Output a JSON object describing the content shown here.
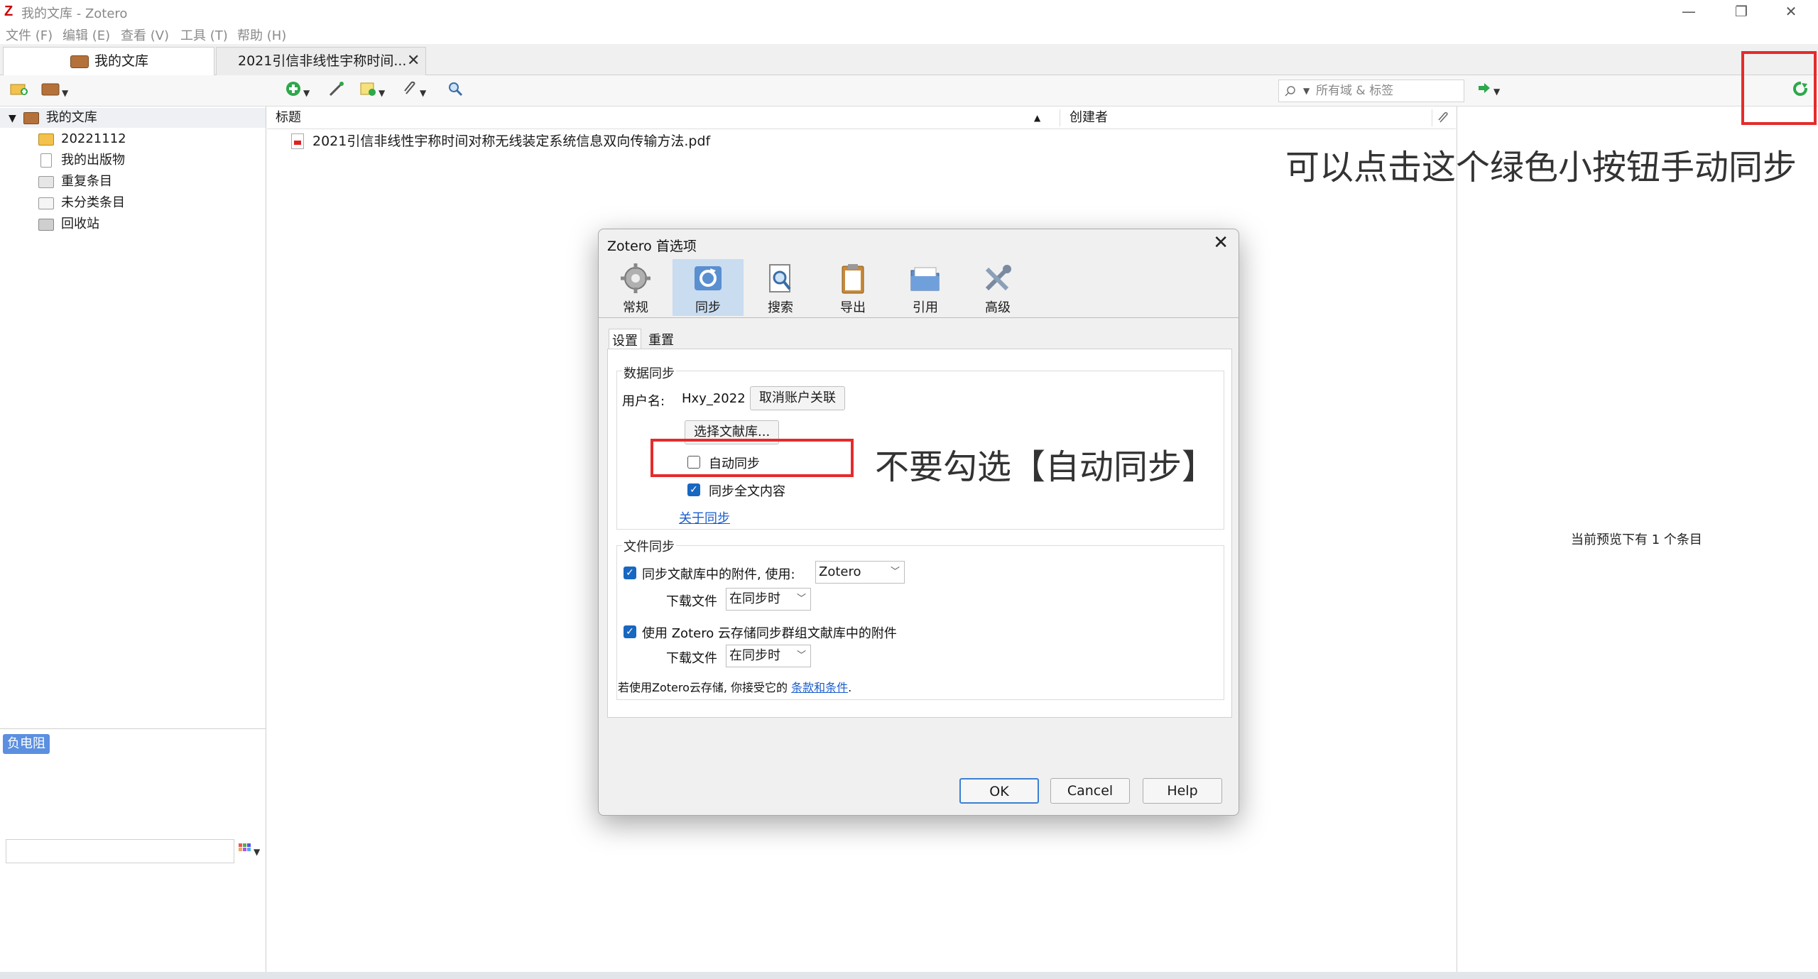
{
  "window": {
    "logo": "Z",
    "title": "我的文库 - Zotero",
    "minimize": "—",
    "restore": "❐",
    "close": "✕"
  },
  "menu": [
    "文件 (F)",
    "编辑 (E)",
    "查看 (V)",
    "工具 (T)",
    "帮助 (H)"
  ],
  "tabs": [
    {
      "label": "我的文库"
    },
    {
      "label": "2021引信非线性宇称时间...",
      "close": "✕"
    }
  ],
  "toolbar": {
    "search_placeholder": "所有域 & 标签",
    "search_icon": "magnifier-icon"
  },
  "collections": {
    "root": "我的文库",
    "items": [
      "20221112",
      "我的出版物",
      "重复条目",
      "未分类条目",
      "回收站"
    ]
  },
  "tags": {
    "chip": "负电阻"
  },
  "columns": {
    "title": "标题",
    "creator": "创建者"
  },
  "items": [
    {
      "title": "2021引信非线性宇称时间对称无线装定系统信息双向传输方法.pdf"
    }
  ],
  "preview": {
    "message": "当前预览下有 1 个条目"
  },
  "annotations": {
    "sync_hint": "可以点击这个绿色小按钮手动同步",
    "auto_sync_hint": "不要勾选【自动同步】"
  },
  "dialog": {
    "title": "Zotero 首选项",
    "panes": [
      "常规",
      "同步",
      "搜索",
      "导出",
      "引用",
      "高级"
    ],
    "selected_pane": "同步",
    "subtabs": [
      "设置",
      "重置"
    ],
    "data_sync": {
      "title": "数据同步",
      "username_label": "用户名:",
      "username": "Hxy_2022",
      "unlink_button": "取消账户关联",
      "choose_libraries_button": "选择文献库...",
      "auto_sync_label": "自动同步",
      "auto_sync_checked": false,
      "fulltext_label": "同步全文内容",
      "fulltext_checked": true,
      "about_link": "关于同步"
    },
    "file_sync": {
      "title": "文件同步",
      "sync_attachments_label": "同步文献库中的附件, 使用:",
      "sync_attachments_checked": true,
      "sync_attachments_service": "Zotero",
      "download_files_label": "下载文件",
      "download_files_value": "在同步时",
      "group_label": "使用 Zotero 云存储同步群组文献库中的附件",
      "group_checked": true,
      "group_download_label": "下载文件",
      "group_download_value": "在同步时",
      "terms_text": "若使用Zotero云存储, 你接受它的",
      "terms_link": "条款和条件",
      "terms_end": "."
    },
    "buttons": {
      "ok": "OK",
      "cancel": "Cancel",
      "help": "Help"
    }
  },
  "colors": {
    "annotation_red": "#e52b2b",
    "accent_blue": "#1867c0",
    "sync_green": "#2da84a"
  }
}
